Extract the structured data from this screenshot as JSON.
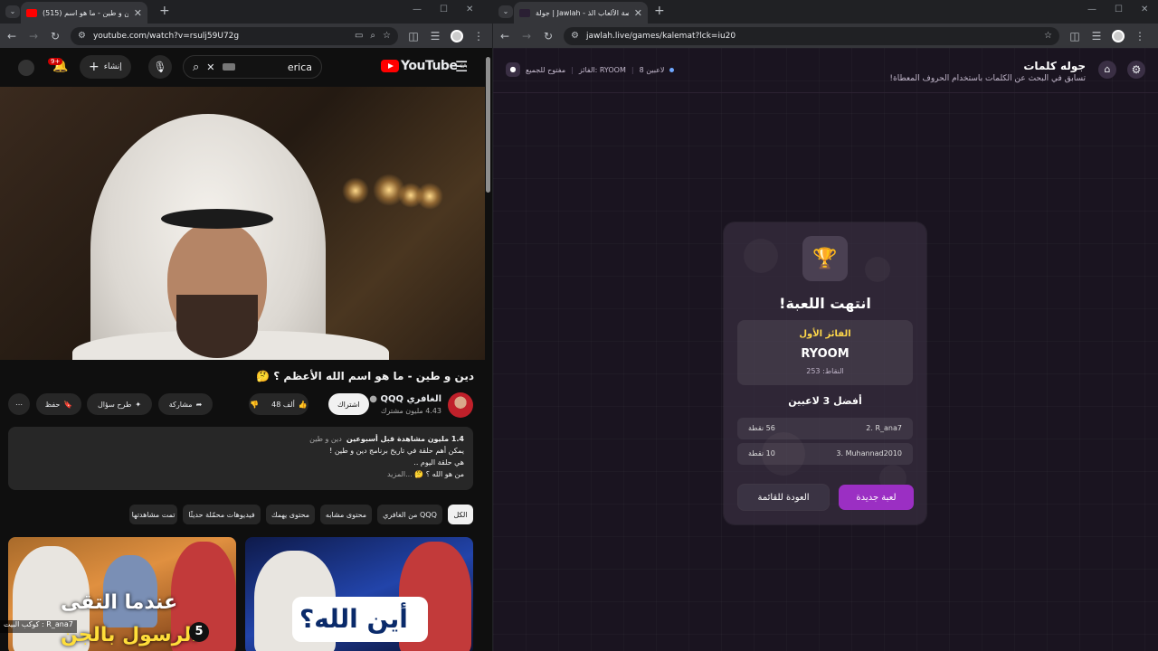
{
  "left_window": {
    "tab": {
      "title": "(515) دين و طين - ما هو اسم"
    },
    "url": "youtube.com/watch?v=rsulj59U72g",
    "youtube": {
      "logo_text": "YouTube",
      "region": "SA",
      "search_value": "erica",
      "create_label": "إنشاء",
      "notif_count": "9+",
      "video_title": "دين و طين - ما هو اسم الله الأعظم ؟ 🤔",
      "channel_name": "الغافري QQQ",
      "channel_subs": "4.43 مليون مشترك",
      "subscribe_label": "اشتراك",
      "like_count": "48 ألف",
      "share_label": "مشاركة",
      "ask_label": "طرح سؤال",
      "save_label": "حفظ",
      "desc_views": "1.4 مليون مشاهدة قبل أسبوعين",
      "desc_tags": "دين و طين",
      "desc_line1": "يمكن أهم حلقة في تاريخ برنامج دين و طين !",
      "desc_line2": "هي حلقة اليوم ..",
      "desc_line3": "من هو الله ؟ 🤔",
      "desc_more": "...المزيد",
      "chips": [
        "الكل",
        "من الغافري QQQ",
        "محتوى مشابه",
        "محتوى يهمك",
        "فيديوهات محمّلة حديثًا",
        "تمت مشاهدتها"
      ],
      "thumb1_caption": "أين الله؟",
      "thumb2_caption_a": "عندما التقى",
      "thumb2_caption_b": "الرسول بالجن",
      "thumb2_badge": "5",
      "live_text": "R_ana7 : كوكب البيت"
    }
  },
  "right_window": {
    "tab": {
      "title": "جولة | Jawlah - منصة الألعاب الذ"
    },
    "url": "jawlah.live/games/kalemat?lck=iu20",
    "header": {
      "title": "جوله كلمات",
      "subtitle": "تسابق في البحث عن الكلمات باستخدام الحروف المعطاة!",
      "players": "8 لاعبين",
      "winner_tag": "الفائز: RYOOM",
      "open_tag": "مفتوح للجميع"
    },
    "result": {
      "title": "انتهت اللعبة!",
      "winner_label": "الفائز الأول",
      "winner_name": "RYOOM",
      "winner_points": "النقاط: 253",
      "top3_label": "أفضل 3 لاعبين",
      "players": [
        {
          "rank_name": "2. R_ana7",
          "score": "56 نقطة"
        },
        {
          "rank_name": "3. Muhannad2010",
          "score": "10 نقطة"
        }
      ],
      "new_game_label": "لعبة جديدة",
      "back_label": "العودة للقائمة"
    }
  }
}
